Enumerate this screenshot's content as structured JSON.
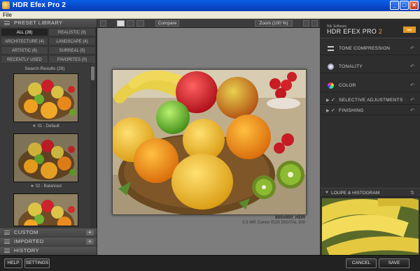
{
  "window": {
    "title": "HDR Efex Pro 2",
    "minimize": "_",
    "maximize": "□",
    "close": "×"
  },
  "menu": {
    "file": "File"
  },
  "left": {
    "preset_library": "PRESET LIBRARY",
    "categories": [
      {
        "label": "ALL (28)",
        "active": true
      },
      {
        "label": "REALISTIC (9)",
        "active": false
      },
      {
        "label": "ARCHITECTURE (4)",
        "active": false
      },
      {
        "label": "LANDSCAPE (4)",
        "active": false
      },
      {
        "label": "ARTISTIC (6)",
        "active": false
      },
      {
        "label": "SURREAL (5)",
        "active": false
      },
      {
        "label": "RECENTLY USED",
        "active": false
      },
      {
        "label": "FAVORITES (0)",
        "active": false
      }
    ],
    "search_results": "Search Results (28)",
    "thumbnails": [
      {
        "label": "01 - Default"
      },
      {
        "label": "02 - Balanced"
      },
      {
        "label": ""
      }
    ],
    "custom": "CUSTOM",
    "imported": "IMPORTED",
    "history": "HISTORY"
  },
  "toolbar": {
    "compare": "Compare",
    "zoom": "Zoom (100 %)"
  },
  "image": {
    "name": "800x600_HDR",
    "meta": "0.5 MP, Canon EOS DIGITAL 300"
  },
  "right": {
    "nik": "Nik Software",
    "product": "HDR EFEX PRO",
    "version": "2",
    "badge": "NIK",
    "sections": {
      "tone_compression": "TONE COMPRESSION",
      "tonality": "TONALITY",
      "color": "COLOR",
      "selective_adjustments": "SELECTIVE ADJUSTMENTS",
      "finishing": "FINISHING"
    },
    "loupe": "LOUPE & HISTOGRAM"
  },
  "bottom": {
    "help": "HELP",
    "settings": "SETTINGS",
    "cancel": "CANCEL",
    "save": "SAVE"
  },
  "colors": {
    "titlebar": "#0846c8",
    "accent": "#f0a030",
    "panel": "#3a3a3a",
    "canvas": "#7d7d7d"
  }
}
